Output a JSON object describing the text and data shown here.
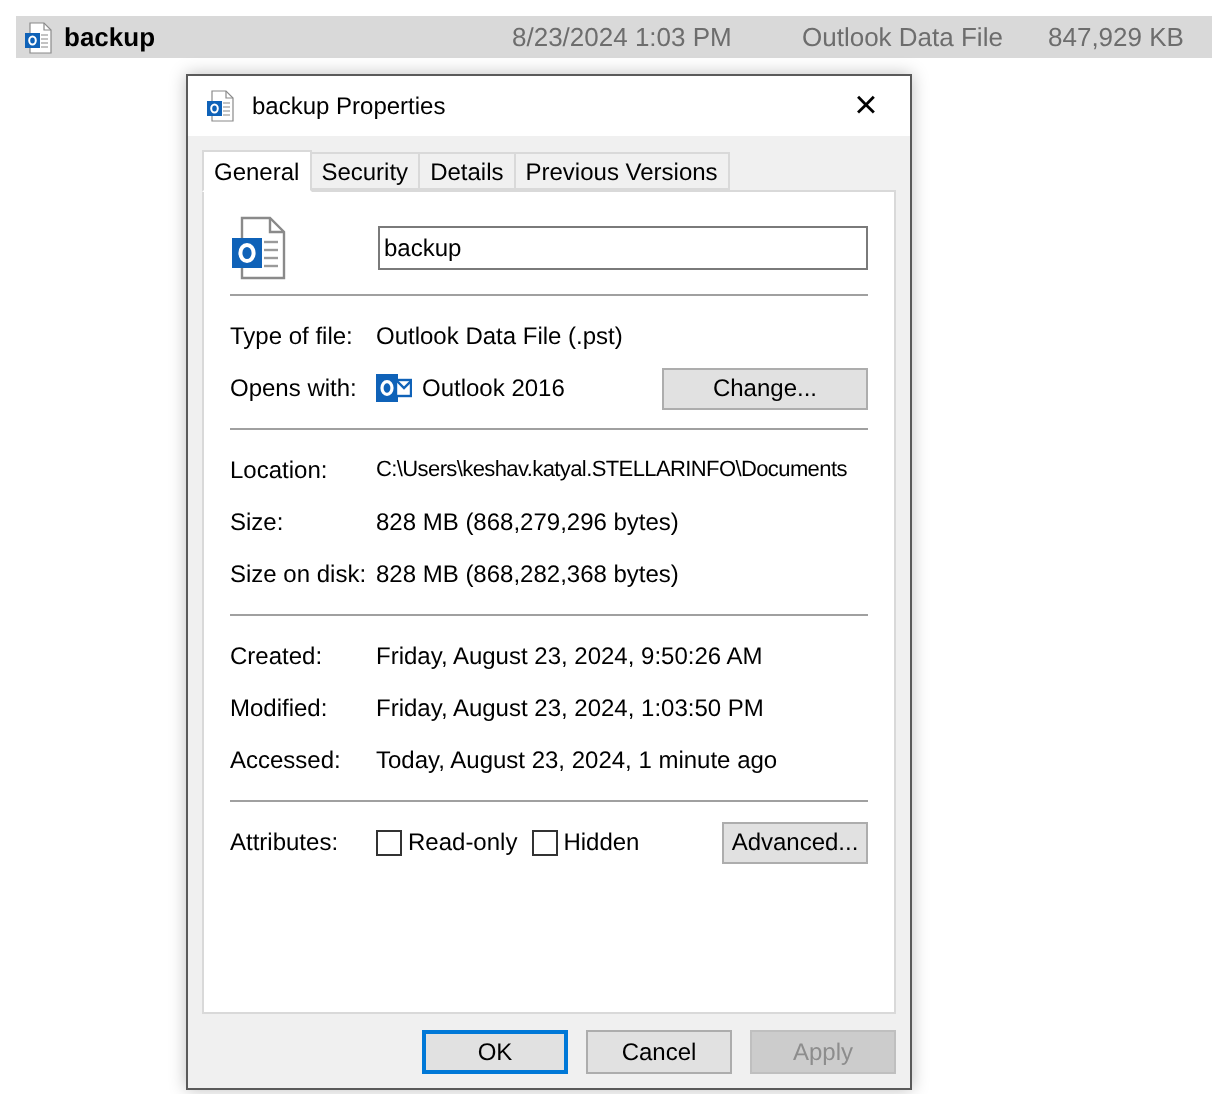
{
  "file_row": {
    "name": "backup",
    "date": "8/23/2024 1:03 PM",
    "type": "Outlook Data File",
    "size": "847,929 KB",
    "selected": true
  },
  "dialog": {
    "title": "backup Properties",
    "close": "×",
    "tabs": [
      {
        "label": "General",
        "selected": true
      },
      {
        "label": "Security",
        "selected": false
      },
      {
        "label": "Details",
        "selected": false
      },
      {
        "label": "Previous Versions",
        "selected": false
      }
    ],
    "name_field": {
      "value": "backup"
    },
    "type_of_file": {
      "label": "Type of file:",
      "value": "Outlook Data File (.pst)"
    },
    "opens_with": {
      "label": "Opens with:",
      "value": "Outlook 2016",
      "button": "Change..."
    },
    "location_group": [
      {
        "label": "Location:",
        "value": "C:\\Users\\keshav.katyal.STELLARINFO\\Documents"
      },
      {
        "label": "Size:",
        "value": "828 MB (868,279,296 bytes)"
      },
      {
        "label": "Size on disk:",
        "value": "828 MB (868,282,368 bytes)"
      }
    ],
    "dates_group": [
      {
        "label": "Created:",
        "value": "Friday, August 23, 2024, 9:50:26 AM"
      },
      {
        "label": "Modified:",
        "value": "Friday, August 23, 2024, 1:03:50 PM"
      },
      {
        "label": "Accessed:",
        "value": "Today, August 23, 2024, 1 minute ago"
      }
    ],
    "attributes": {
      "label": "Attributes:",
      "options": [
        {
          "label": "Read-only",
          "checked": false
        },
        {
          "label": "Hidden",
          "checked": false
        }
      ],
      "button": "Advanced..."
    },
    "buttons": [
      {
        "label": "OK",
        "default": true,
        "disabled": false
      },
      {
        "label": "Cancel",
        "default": false,
        "disabled": false
      },
      {
        "label": "Apply",
        "default": false,
        "disabled": true
      }
    ]
  }
}
